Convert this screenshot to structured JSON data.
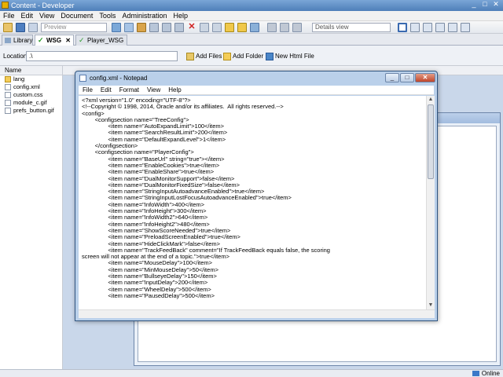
{
  "window": {
    "title": "Content - Developer"
  },
  "menubar": [
    "File",
    "Edit",
    "View",
    "Document",
    "Tools",
    "Administration",
    "Help"
  ],
  "toolbar": {
    "preview_label": "Preview",
    "view_select": "Details view"
  },
  "tabs": [
    {
      "label": "Library",
      "active": false
    },
    {
      "label": "WSG",
      "active": true
    },
    {
      "label": "Player_WSG",
      "active": false
    }
  ],
  "location": {
    "label": "Location:",
    "value": ".\\"
  },
  "location_actions": {
    "add_files": "Add Files",
    "add_folder": "Add Folder",
    "new_html_file": "New Html File"
  },
  "files": {
    "column_name": "Name",
    "items": [
      {
        "name": "lang",
        "type": "folder"
      },
      {
        "name": "config.xml",
        "type": "file"
      },
      {
        "name": "custom.css",
        "type": "file"
      },
      {
        "name": "module_c.gif",
        "type": "file"
      },
      {
        "name": "prefs_button.gif",
        "type": "file"
      }
    ]
  },
  "status": {
    "online": "Online"
  },
  "notepad": {
    "title": "config.xml - Notepad",
    "menu": [
      "File",
      "Edit",
      "Format",
      "View",
      "Help"
    ],
    "lines": [
      "<?xml version=\"1.0\" encoding=\"UTF-8\"?>",
      "<!--Copyright © 1998, 2014, Oracle and/or its affiliates.  All rights reserved.-->",
      "<config>",
      "        <configsection name=\"TreeConfig\">",
      "                <item name=\"AutoExpandLimit\">100</item>",
      "                <item name=\"SearchResultLimit\">200</item>",
      "                <item name=\"DefaultExpandLevel\">1</item>",
      "        </configsection>",
      "        <configsection name=\"PlayerConfig\">",
      "                <item name=\"BaseUrl\" string=\"true\"></item>",
      "                <item name=\"EnableCookies\">true</item>",
      "                <item name=\"EnableShare\">true</item>",
      "                <item name=\"DualMonitorSupport\">false</item>",
      "                <item name=\"DualMonitorFixedSize\">false</item>",
      "                <item name=\"StringInputAutoadvanceEnabled\">true</item>",
      "                <item name=\"StringInputLostFocusAutoadvanceEnabled\">true</item>",
      "                <item name=\"InfoWidth\">400</item>",
      "                <item name=\"InfoHeight\">300</item>",
      "                <item name=\"InfoWidth2\">640</item>",
      "                <item name=\"InfoHeight2\">480</item>",
      "                <item name=\"ShowScoreNeeded\">true</item>",
      "                <item name=\"PreloadScreenEnabled\">true</item>",
      "                <item name=\"HideClickMark\">false</item>",
      "                <item name=\"TrackFeedBack\" comment=\"If TrackFeedBack equals false, the scoring",
      "screen will not appear at the end of a topic.\">true</item>",
      "                <item name=\"MouseDelay\">100</item>",
      "                <item name=\"MinMouseDelay\">50</item>",
      "                <item name=\"BullseyeDelay\">150</item>",
      "                <item name=\"InputDelay\">200</item>",
      "                <item name=\"WheelDelay\">500</item>",
      "                <item name=\"PausedDelay\">500</item>"
    ]
  }
}
